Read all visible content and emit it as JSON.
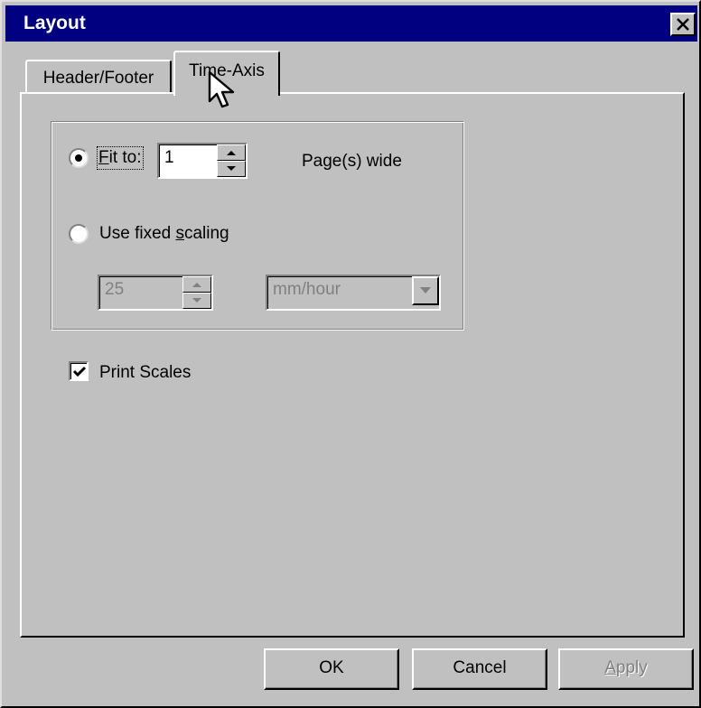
{
  "window": {
    "title": "Layout",
    "close_icon": "close-icon"
  },
  "tabs": [
    {
      "label": "Header/Footer",
      "active": false
    },
    {
      "label": "Time-Axis",
      "active": true
    }
  ],
  "scaling_group": {
    "fit_to": {
      "label_prefix": "",
      "label_accel": "F",
      "label_rest": "it to:",
      "selected": true,
      "value": "1",
      "units_label": "Page(s) wide"
    },
    "fixed_scaling": {
      "label_before": "Use fixed ",
      "label_accel": "s",
      "label_after": "caling",
      "selected": false,
      "value": "25",
      "unit_selected": "mm/hour",
      "disabled": true
    }
  },
  "print_scales": {
    "label": "Print Scales",
    "checked": true
  },
  "buttons": {
    "ok": "OK",
    "cancel": "Cancel",
    "apply_accel": "A",
    "apply_rest": "pply"
  },
  "colors": {
    "titlebar": "#000080",
    "face": "#c0c0c0",
    "disabled_text": "#808080"
  }
}
